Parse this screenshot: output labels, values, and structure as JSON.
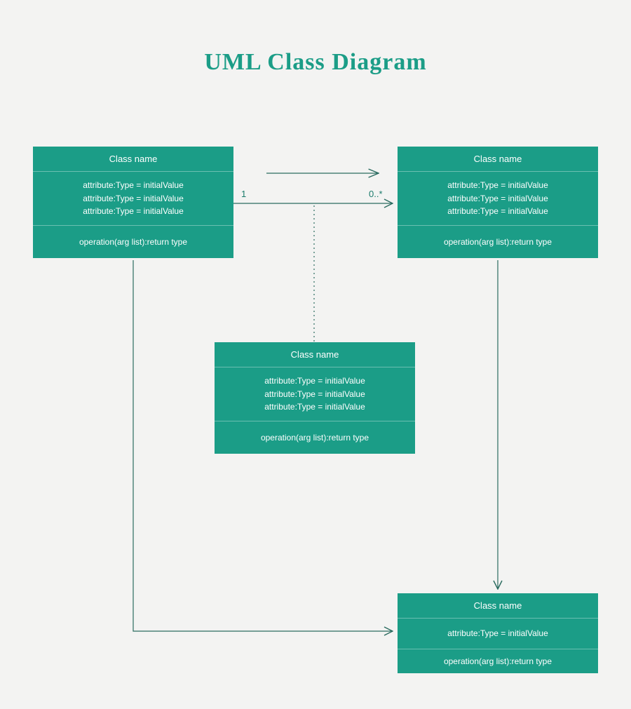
{
  "title": "UML Class Diagram",
  "colors": {
    "brand": "#1b9d87",
    "bg": "#f3f3f2"
  },
  "multiplicity": {
    "left": "1",
    "right": "0..*"
  },
  "classes": {
    "topLeft": {
      "name": "Class name",
      "attributes": [
        "attribute:Type = initialValue",
        "attribute:Type = initialValue",
        "attribute:Type = initialValue"
      ],
      "operations": [
        "operation(arg list):return type"
      ]
    },
    "topRight": {
      "name": "Class name",
      "attributes": [
        "attribute:Type = initialValue",
        "attribute:Type = initialValue",
        "attribute:Type = initialValue"
      ],
      "operations": [
        "operation(arg list):return type"
      ]
    },
    "middle": {
      "name": "Class name",
      "attributes": [
        "attribute:Type = initialValue",
        "attribute:Type = initialValue",
        "attribute:Type = initialValue"
      ],
      "operations": [
        "operation(arg list):return type"
      ]
    },
    "bottom": {
      "name": "Class name",
      "attributes": [
        "attribute:Type = initialValue"
      ],
      "operations": [
        "operation(arg list):return type"
      ]
    }
  },
  "connectors": [
    {
      "type": "generalization",
      "from": "topLeft",
      "to": "topRight"
    },
    {
      "type": "association",
      "from": "topLeft",
      "to": "topRight",
      "leftMult": "1",
      "rightMult": "0..*"
    },
    {
      "type": "dependency-dotted",
      "from": "association-midpoint",
      "to": "middle"
    },
    {
      "type": "association-arrow",
      "from": "topLeft",
      "to": "bottom"
    },
    {
      "type": "association-arrow",
      "from": "topRight",
      "to": "bottom"
    }
  ]
}
